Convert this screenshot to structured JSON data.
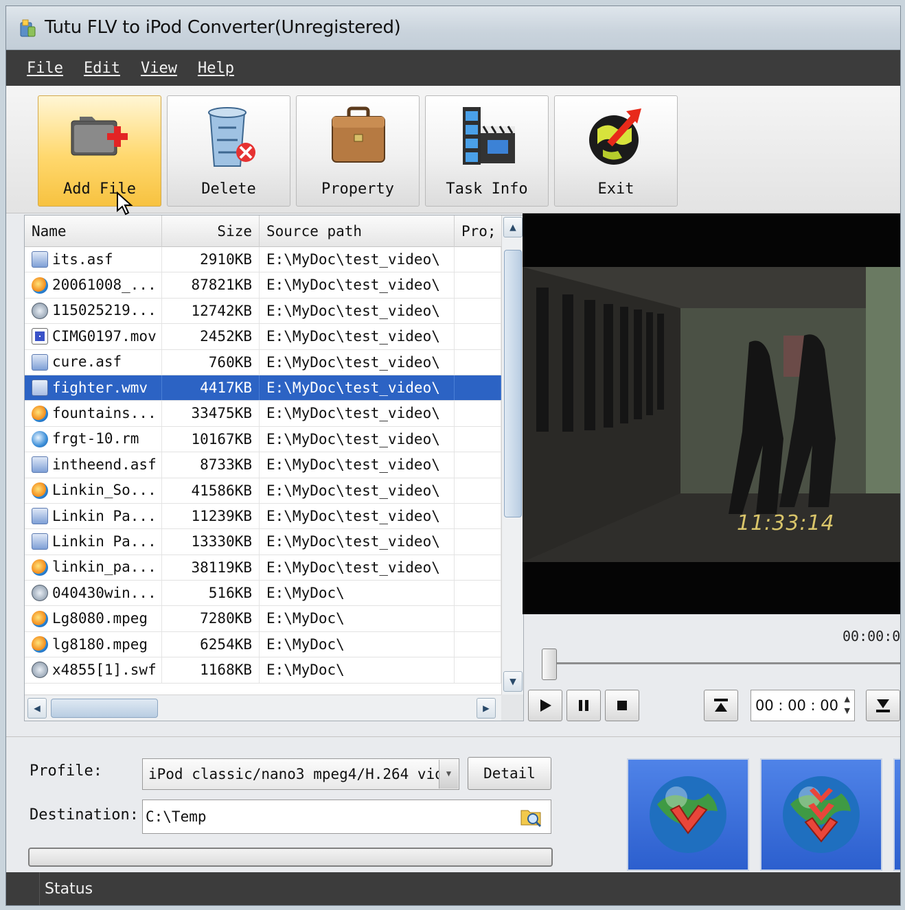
{
  "window": {
    "title": "Tutu FLV to iPod Converter(Unregistered)"
  },
  "menu": [
    "File",
    "Edit",
    "View",
    "Help"
  ],
  "toolbar": {
    "add_file": "Add File",
    "delete": "Delete",
    "property": "Property",
    "task_info": "Task Info",
    "exit": "Exit"
  },
  "filelist": {
    "columns": [
      "Name",
      "Size",
      "Source path",
      "Pro;"
    ],
    "rows": [
      {
        "icon": "asf-file-icon",
        "name": "its.asf",
        "size": "2910KB",
        "path": "E:\\MyDoc\\test_video\\"
      },
      {
        "icon": "media-file-icon",
        "name": "20061008_...",
        "size": "87821KB",
        "path": "E:\\MyDoc\\test_video\\"
      },
      {
        "icon": "swf-file-icon",
        "name": "115025219...",
        "size": "12742KB",
        "path": "E:\\MyDoc\\test_video\\"
      },
      {
        "icon": "mov-file-icon",
        "name": "CIMG0197.mov",
        "size": "2452KB",
        "path": "E:\\MyDoc\\test_video\\"
      },
      {
        "icon": "asf-file-icon",
        "name": "cure.asf",
        "size": "760KB",
        "path": "E:\\MyDoc\\test_video\\"
      },
      {
        "icon": "wmv-file-icon",
        "name": "fighter.wmv",
        "size": "4417KB",
        "path": "E:\\MyDoc\\test_video\\",
        "selected": true
      },
      {
        "icon": "media-file-icon",
        "name": "fountains...",
        "size": "33475KB",
        "path": "E:\\MyDoc\\test_video\\"
      },
      {
        "icon": "rm-file-icon",
        "name": "frgt-10.rm",
        "size": "10167KB",
        "path": "E:\\MyDoc\\test_video\\"
      },
      {
        "icon": "asf-file-icon",
        "name": "intheend.asf",
        "size": "8733KB",
        "path": "E:\\MyDoc\\test_video\\"
      },
      {
        "icon": "media-file-icon",
        "name": "Linkin_So...",
        "size": "41586KB",
        "path": "E:\\MyDoc\\test_video\\"
      },
      {
        "icon": "asf-file-icon",
        "name": "Linkin Pa...",
        "size": "11239KB",
        "path": "E:\\MyDoc\\test_video\\"
      },
      {
        "icon": "asf-file-icon",
        "name": "Linkin Pa...",
        "size": "13330KB",
        "path": "E:\\MyDoc\\test_video\\"
      },
      {
        "icon": "media-file-icon",
        "name": "linkin_pa...",
        "size": "38119KB",
        "path": "E:\\MyDoc\\test_video\\"
      },
      {
        "icon": "swf-file-icon",
        "name": "040430win...",
        "size": "516KB",
        "path": "E:\\MyDoc\\"
      },
      {
        "icon": "media-file-icon",
        "name": "Lg8080.mpeg",
        "size": "7280KB",
        "path": "E:\\MyDoc\\"
      },
      {
        "icon": "media-file-icon",
        "name": "lg8180.mpeg",
        "size": "6254KB",
        "path": "E:\\MyDoc\\"
      },
      {
        "icon": "swf-file-icon",
        "name": "x4855[1].swf",
        "size": "1168KB",
        "path": "E:\\MyDoc\\"
      }
    ]
  },
  "preview": {
    "timestamp": "11:33:14"
  },
  "player": {
    "current_time": "00:00:0",
    "time_field": "00 : 00 : 00"
  },
  "settings": {
    "profile_label": "Profile:",
    "profile_value": "iPod classic/nano3 mpeg4/H.264 vid",
    "detail_label": "Detail",
    "destination_label": "Destination:",
    "destination_value": "C:\\Temp",
    "progress": 0
  },
  "status": {
    "label": "Status"
  }
}
